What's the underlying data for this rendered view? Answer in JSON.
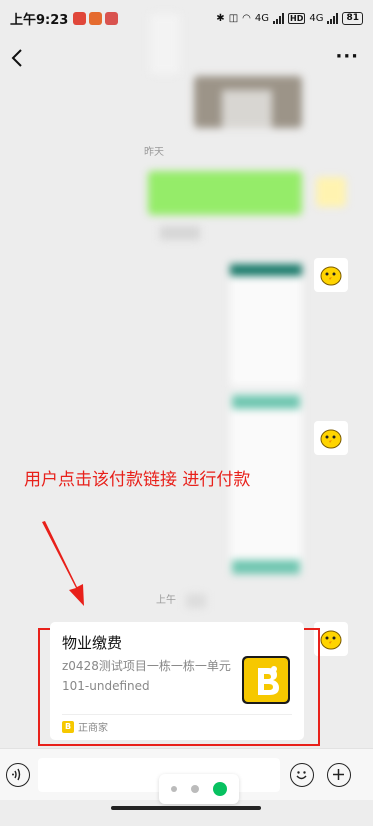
{
  "status": {
    "time": "上午9:23",
    "net1": "4G",
    "hd": "HD",
    "net2": "4G",
    "battery": "81"
  },
  "nav": {
    "more_label": "···"
  },
  "chat": {
    "time_yesterday": "昨天",
    "time_morning": "上午"
  },
  "annotation": "用户点击该付款链接 进行付款",
  "card": {
    "title": "物业缴费",
    "description": "z0428测试项目一栋一栋一单元101-undefined",
    "source": "正商家"
  },
  "colors": {
    "accent_red": "#e8201a",
    "bubble_green": "#95ec69",
    "pager_green": "#07c160"
  }
}
